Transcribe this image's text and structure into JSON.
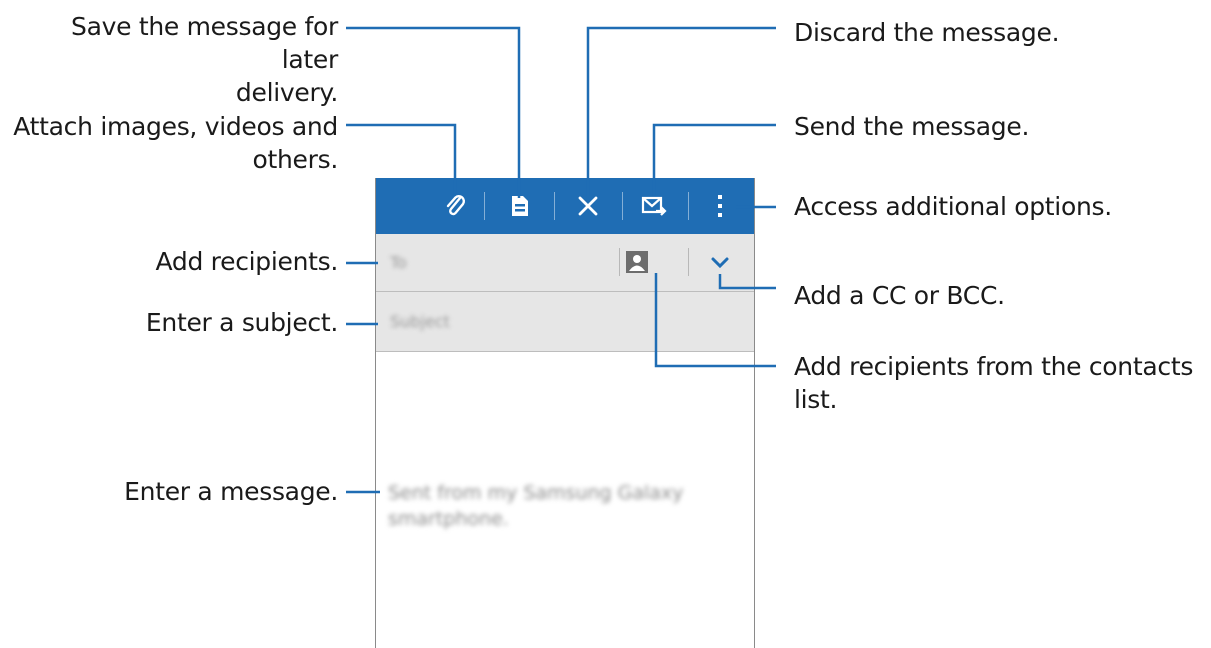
{
  "callouts": {
    "save": "Save the message for later\ndelivery.",
    "attach": "Attach images, videos and\nothers.",
    "add_recipients": "Add recipients.",
    "enter_subject": "Enter a subject.",
    "enter_message": "Enter a message.",
    "discard": "Discard the message.",
    "send": "Send the message.",
    "more_options": "Access additional options.",
    "cc_bcc": "Add a CC or BCC.",
    "contacts": "Add recipients from the contacts\nlist."
  },
  "compose": {
    "to_placeholder": "To",
    "subject_placeholder": "Subject",
    "body": "Sent from my Samsung Galaxy smartphone."
  },
  "toolbar": {
    "icons": [
      "paperclip-icon",
      "save-icon",
      "close-icon",
      "send-icon",
      "more-vert-icon"
    ]
  },
  "colors": {
    "actionbar": "#1f6db4",
    "callout_line": "#1f6db4",
    "field_bg": "#e6e6e6"
  }
}
